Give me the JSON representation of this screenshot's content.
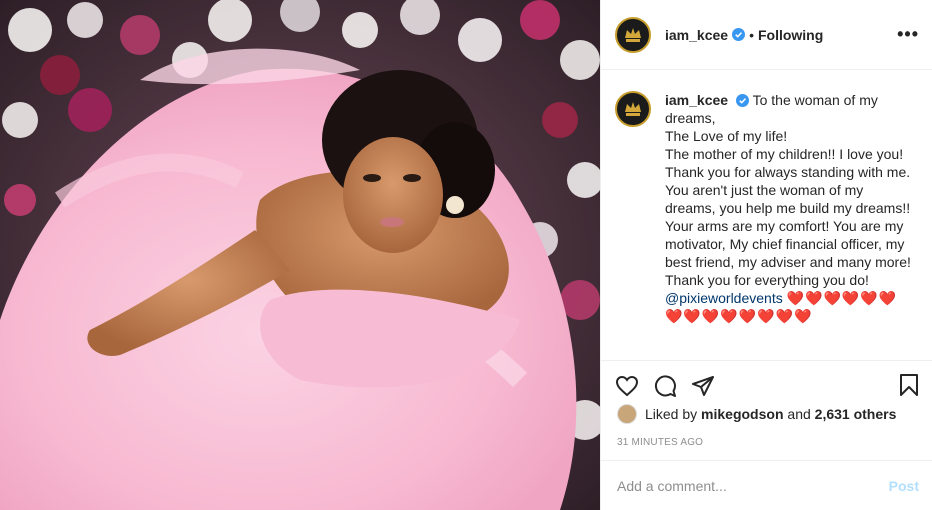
{
  "post": {
    "username": "iam_kcee",
    "separator": "•",
    "follow_status": "Following",
    "more_label": "•••"
  },
  "caption": {
    "username": "iam_kcee",
    "lines": [
      "To the woman of my dreams,",
      "The Love of my life!",
      "The mother of my children!! I love you!",
      "Thank you for always standing with me. You aren't just the woman of my dreams, you help me build my dreams!! Your arms are my comfort! You are my motivator, My chief financial officer, my best friend, my adviser and many more!",
      "Thank you for everything you do!"
    ],
    "mention": "@pixieworldevents",
    "hearts_line1": "❤️❤️❤️❤️❤️❤️",
    "hearts_line2": "❤️❤️❤️❤️❤️❤️❤️❤️"
  },
  "likes": {
    "prefix": "Liked by",
    "user": "mikegodson",
    "conjunction": "and",
    "others": "2,631 others"
  },
  "timestamp": "31 MINUTES AGO",
  "comment": {
    "placeholder": "Add a comment...",
    "post_label": "Post"
  },
  "icons": [
    "heart-icon",
    "comment-icon",
    "share-icon",
    "bookmark-icon",
    "verified-icon",
    "more-icon"
  ],
  "colors": {
    "verified": "#3897f0",
    "heart_emoji": "#e0142a",
    "mention": "#00376b",
    "post_disabled": "#b2dffc",
    "muted": "#8e8e8e",
    "avatar_ring": "#c69c2b"
  }
}
